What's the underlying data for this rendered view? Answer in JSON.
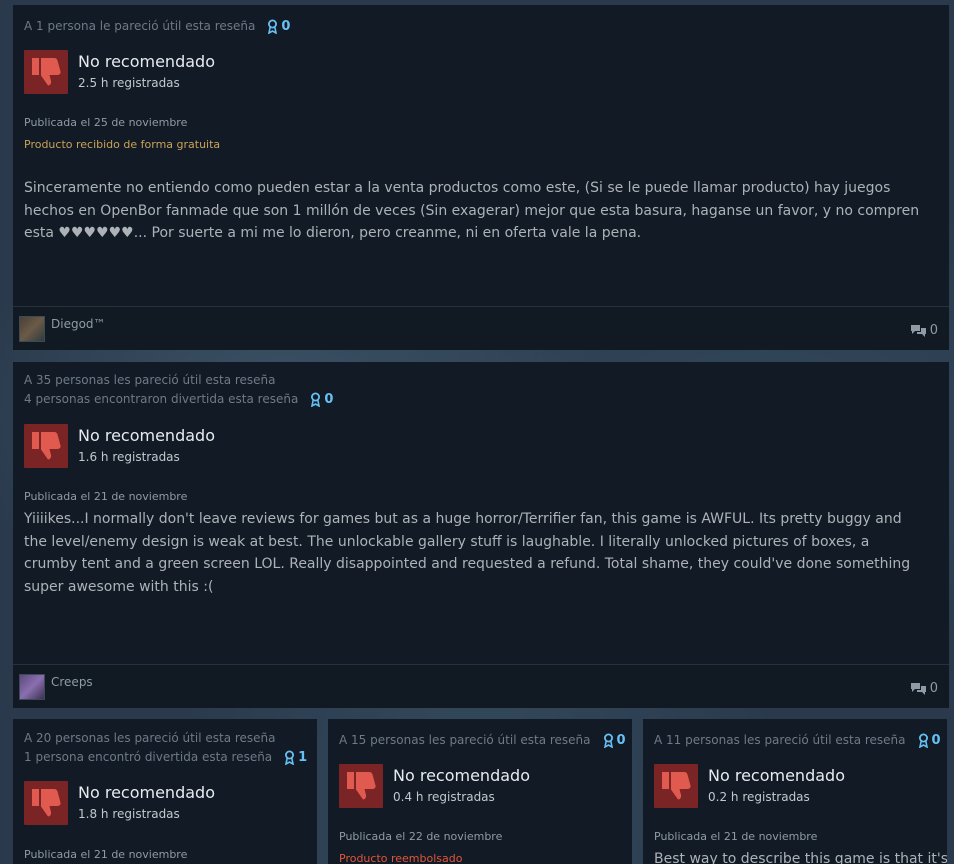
{
  "reviews": [
    {
      "helpful": "A 1 persona le pareció útil esta reseña",
      "funny": "",
      "awards": "0",
      "verdict": "No recomendado",
      "hours": "2.5 h registradas",
      "posted": "Publicada el 25 de noviembre",
      "note": "Producto recibido de forma gratuita",
      "body": "Sinceramente no entiendo como pueden estar a la venta productos como este, (Si se le puede llamar producto) hay juegos hechos en OpenBor fanmade que son 1 millón de veces (Sin exagerar) mejor que esta basura, haganse un favor, y no compren esta ♥♥♥♥♥♥... Por suerte a mi me lo dieron, pero creanme, ni en oferta vale la pena.",
      "author": "Diegod™",
      "comments": "0"
    },
    {
      "helpful": "A 35 personas les pareció útil esta reseña",
      "funny": "4 personas encontraron divertida esta reseña",
      "awards": "0",
      "verdict": "No recomendado",
      "hours": "1.6 h registradas",
      "posted": "Publicada el 21 de noviembre",
      "note": "",
      "body": "Yiiiikes...I normally don't leave reviews for games but as a huge horror/Terrifier fan, this game is AWFUL. Its pretty buggy and the level/enemy design is weak at best. The unlockable gallery stuff is laughable. I literally unlocked pictures of boxes, a crumby tent and a green screen LOL. Really disappointed and requested a refund. Total shame, they could've done something super awesome with this :(",
      "author": "Creeps",
      "comments": "0"
    },
    {
      "helpful": "A 20 personas les pareció útil esta reseña",
      "funny": "1 persona encontró divertida esta reseña",
      "awards": "1",
      "verdict": "No recomendado",
      "hours": "1.8 h registradas",
      "posted": "Publicada el 21 de noviembre"
    },
    {
      "helpful": "A 15 personas les pareció útil esta reseña",
      "awards": "0",
      "verdict": "No recomendado",
      "hours": "0.4 h registradas",
      "posted": "Publicada el 22 de noviembre",
      "note": "Producto reembolsado"
    },
    {
      "helpful": "A 11 personas les pareció útil esta reseña",
      "awards": "0",
      "verdict": "No recomendado",
      "hours": "0.2 h registradas",
      "posted": "Publicada el 21 de noviembre",
      "body": "Best way to describe this game is that it's"
    }
  ],
  "icons": {
    "thumb": "thumbs-down-icon",
    "award": "award-ribbon-icon",
    "comment": "comment-bubble-icon"
  },
  "colors": {
    "card_bg": "#121a25",
    "thumb_bg": "#7a2425",
    "thumb_fg": "#e05a4f",
    "award": "#66c0f4",
    "free_note": "#c9a259",
    "refund_note": "#e0563a"
  }
}
